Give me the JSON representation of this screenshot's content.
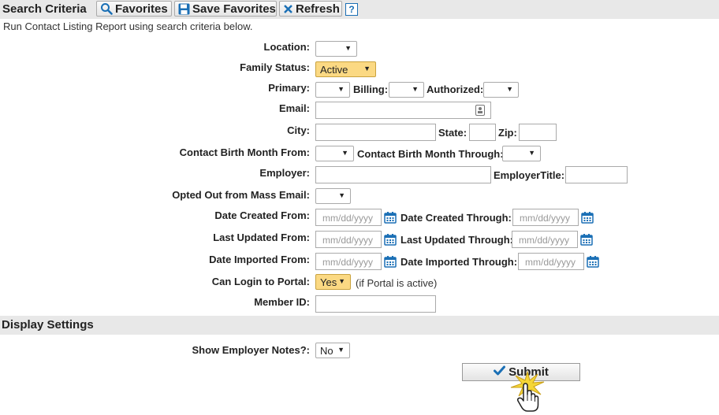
{
  "header": {
    "title": "Search Criteria",
    "favorites": "Favorites",
    "save_favorites": "Save Favorites",
    "refresh": "Refresh",
    "help": "?"
  },
  "subtitle": "Run Contact Listing Report using search criteria below.",
  "form": {
    "location": {
      "label": "Location:",
      "value": ""
    },
    "family_status": {
      "label": "Family Status:",
      "value": "Active"
    },
    "primary": {
      "label": "Primary:",
      "value": ""
    },
    "billing": {
      "label": "Billing:",
      "value": ""
    },
    "authorized": {
      "label": "Authorized:",
      "value": ""
    },
    "email": {
      "label": "Email:",
      "value": ""
    },
    "city": {
      "label": "City:",
      "value": ""
    },
    "state": {
      "label": "State:",
      "value": ""
    },
    "zip": {
      "label": "Zip:",
      "value": ""
    },
    "birth_from": {
      "label": "Contact Birth Month From:",
      "value": ""
    },
    "birth_through": {
      "label": "Contact Birth Month Through:",
      "value": ""
    },
    "employer": {
      "label": "Employer:",
      "value": ""
    },
    "employer_title": {
      "label": "EmployerTitle:",
      "value": ""
    },
    "opted_out": {
      "label": "Opted Out from Mass Email:",
      "value": ""
    },
    "date_created_from": {
      "label": "Date Created From:",
      "placeholder": "mm/dd/yyyy"
    },
    "date_created_through": {
      "label": "Date Created Through:",
      "placeholder": "mm/dd/yyyy"
    },
    "last_updated_from": {
      "label": "Last Updated From:",
      "placeholder": "mm/dd/yyyy"
    },
    "last_updated_through": {
      "label": "Last Updated Through:",
      "placeholder": "mm/dd/yyyy"
    },
    "date_imported_from": {
      "label": "Date Imported From:",
      "placeholder": "mm/dd/yyyy"
    },
    "date_imported_through": {
      "label": "Date Imported Through:",
      "placeholder": "mm/dd/yyyy"
    },
    "can_login": {
      "label": "Can Login to Portal:",
      "value": "Yes",
      "note": "(if Portal is active)"
    },
    "member_id": {
      "label": "Member ID:",
      "value": ""
    }
  },
  "display": {
    "title": "Display Settings",
    "show_employer_notes": {
      "label": "Show Employer Notes?:",
      "value": "No"
    }
  },
  "submit_label": "Submit",
  "colors": {
    "accent": "#1a6fb5",
    "highlight": "#fbd983",
    "bar": "#e8e8e8"
  }
}
